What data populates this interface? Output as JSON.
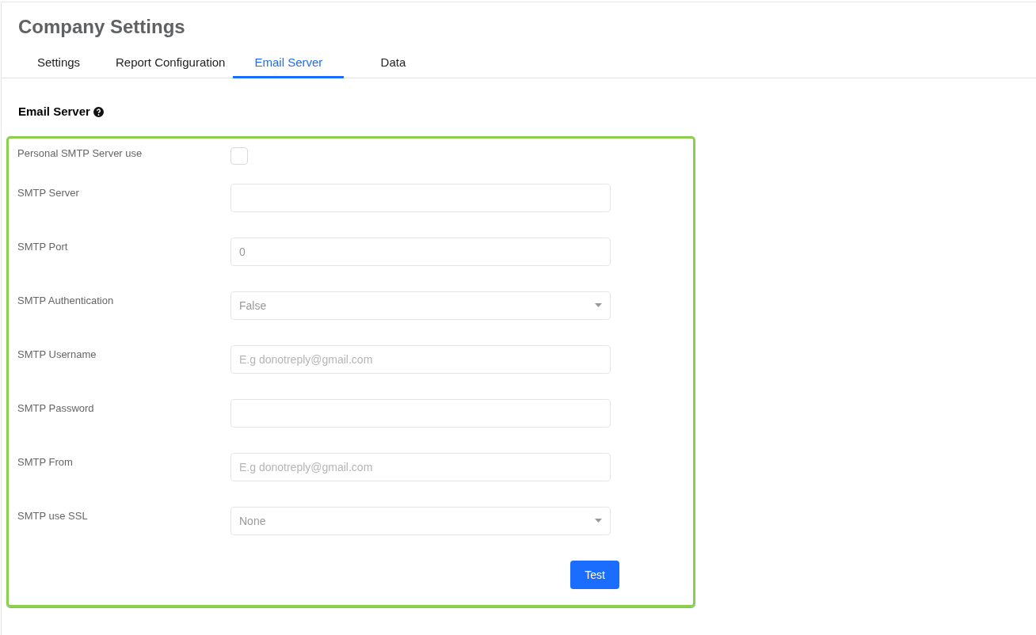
{
  "page": {
    "title": "Company Settings"
  },
  "tabs": [
    {
      "label": "Settings",
      "selected": false
    },
    {
      "label": "Report Configuration",
      "selected": false
    },
    {
      "label": "Email Server",
      "selected": true
    },
    {
      "label": "Data",
      "selected": false
    }
  ],
  "section": {
    "title": "Email Server"
  },
  "fields": [
    {
      "label": "Personal SMTP Server use",
      "kind": "checkbox",
      "checked": false
    },
    {
      "label": "SMTP Server",
      "kind": "text"
    },
    {
      "label": "SMTP Port",
      "kind": "text",
      "value": "0"
    },
    {
      "label": "SMTP Authentication",
      "kind": "select",
      "value": "False"
    },
    {
      "label": "SMTP Username",
      "kind": "text",
      "placeholder": "E.g donotreply@gmail.com"
    },
    {
      "label": "SMTP Password",
      "kind": "password"
    },
    {
      "label": "SMTP From",
      "kind": "text",
      "placeholder": "E.g donotreply@gmail.com"
    },
    {
      "label": "SMTP use SSL",
      "kind": "select",
      "value": "None"
    }
  ],
  "buttons": [
    "Test"
  ]
}
